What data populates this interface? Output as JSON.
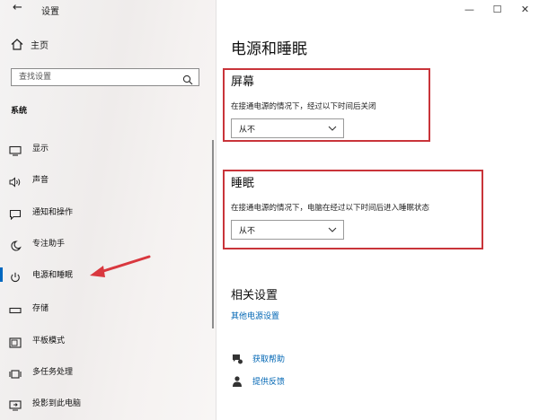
{
  "window": {
    "app_title": "设置",
    "controls": {
      "minimize": "—",
      "maximize": "☐",
      "close": "✕"
    }
  },
  "sidebar": {
    "home_label": "主页",
    "search": {
      "placeholder": "查找设置"
    },
    "section_label": "系统",
    "items": [
      {
        "label": "显示",
        "icon": "display-icon"
      },
      {
        "label": "声音",
        "icon": "speaker-icon"
      },
      {
        "label": "通知和操作",
        "icon": "notification-icon"
      },
      {
        "label": "专注助手",
        "icon": "moon-icon"
      },
      {
        "label": "电源和睡眠",
        "icon": "power-icon",
        "active": true
      },
      {
        "label": "存储",
        "icon": "storage-icon"
      },
      {
        "label": "平板模式",
        "icon": "tablet-icon"
      },
      {
        "label": "多任务处理",
        "icon": "multitask-icon"
      },
      {
        "label": "投影到此电脑",
        "icon": "project-icon"
      }
    ]
  },
  "main": {
    "page_title": "电源和睡眠",
    "screen": {
      "title": "屏幕",
      "description": "在接通电源的情况下，经过以下时间后关闭",
      "selected": "从不"
    },
    "sleep": {
      "title": "睡眠",
      "description": "在接通电源的情况下，电脑在经过以下时间后进入睡眠状态",
      "selected": "从不"
    },
    "related": {
      "title": "相关设置",
      "link": "其他电源设置"
    },
    "help": {
      "get_help": "获取帮助",
      "feedback": "提供反馈"
    }
  },
  "colors": {
    "accent": "#0067c0",
    "link": "#0066b4",
    "highlight_box": "#c9343a",
    "arrow": "#d9373e"
  }
}
